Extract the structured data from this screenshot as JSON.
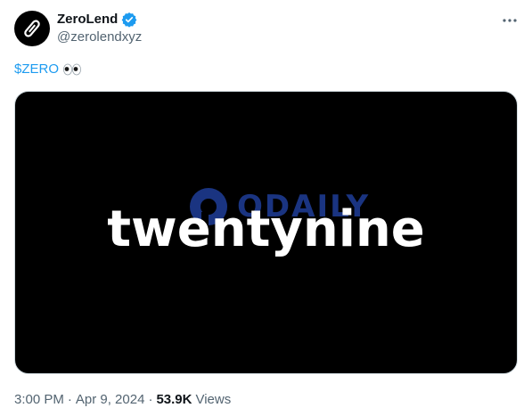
{
  "author": {
    "name": "ZeroLend",
    "handle": "@zerolendxyz",
    "verified": true,
    "avatar_icon": "paperclip-logo-icon",
    "verified_color": "#1d9bf0"
  },
  "menu": {
    "more_icon": "more-horizontal-icon"
  },
  "tweet": {
    "cashtag": "$ZERO",
    "emoji": "eyes-emoji"
  },
  "media": {
    "wordmark": "twentynine",
    "watermark": "ODAILY",
    "background": "#000000"
  },
  "meta": {
    "time": "3:00 PM",
    "separator1": "·",
    "date": "Apr 9, 2024",
    "separator2": "·",
    "views_count": "53.9K",
    "views_label": "Views"
  },
  "colors": {
    "link": "#1d9bf0",
    "secondary_text": "#536471",
    "primary_text": "#0f1419"
  }
}
